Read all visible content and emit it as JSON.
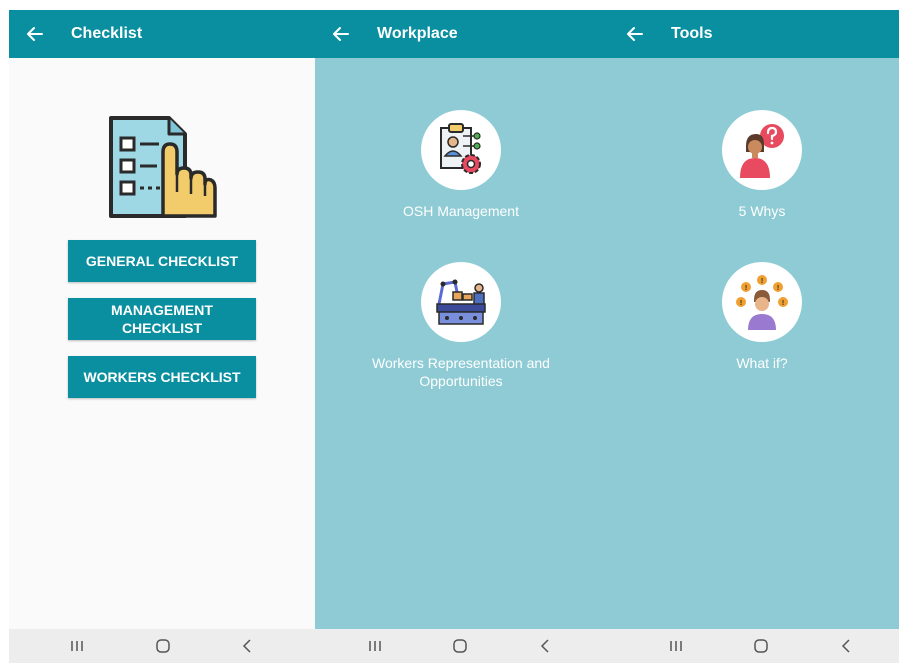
{
  "screens": [
    {
      "title": "Checklist",
      "buttons": [
        "GENERAL CHECKLIST",
        "MANAGEMENT CHECKLIST",
        "WORKERS CHECKLIST"
      ]
    },
    {
      "title": "Workplace",
      "items": [
        "OSH Management",
        "Workers Representation and Opportunities"
      ]
    },
    {
      "title": "Tools",
      "items": [
        "5 Whys",
        "What if?"
      ]
    }
  ],
  "colors": {
    "appbar": "#0a8fa0",
    "content_bg": "#8ecbd4",
    "button": "#0a8fa0",
    "navbar": "#ededed"
  },
  "icons": {
    "back": "arrow-left-icon",
    "nav_recents": "recents-icon",
    "nav_home": "home-icon",
    "nav_back": "chevron-left-icon"
  }
}
